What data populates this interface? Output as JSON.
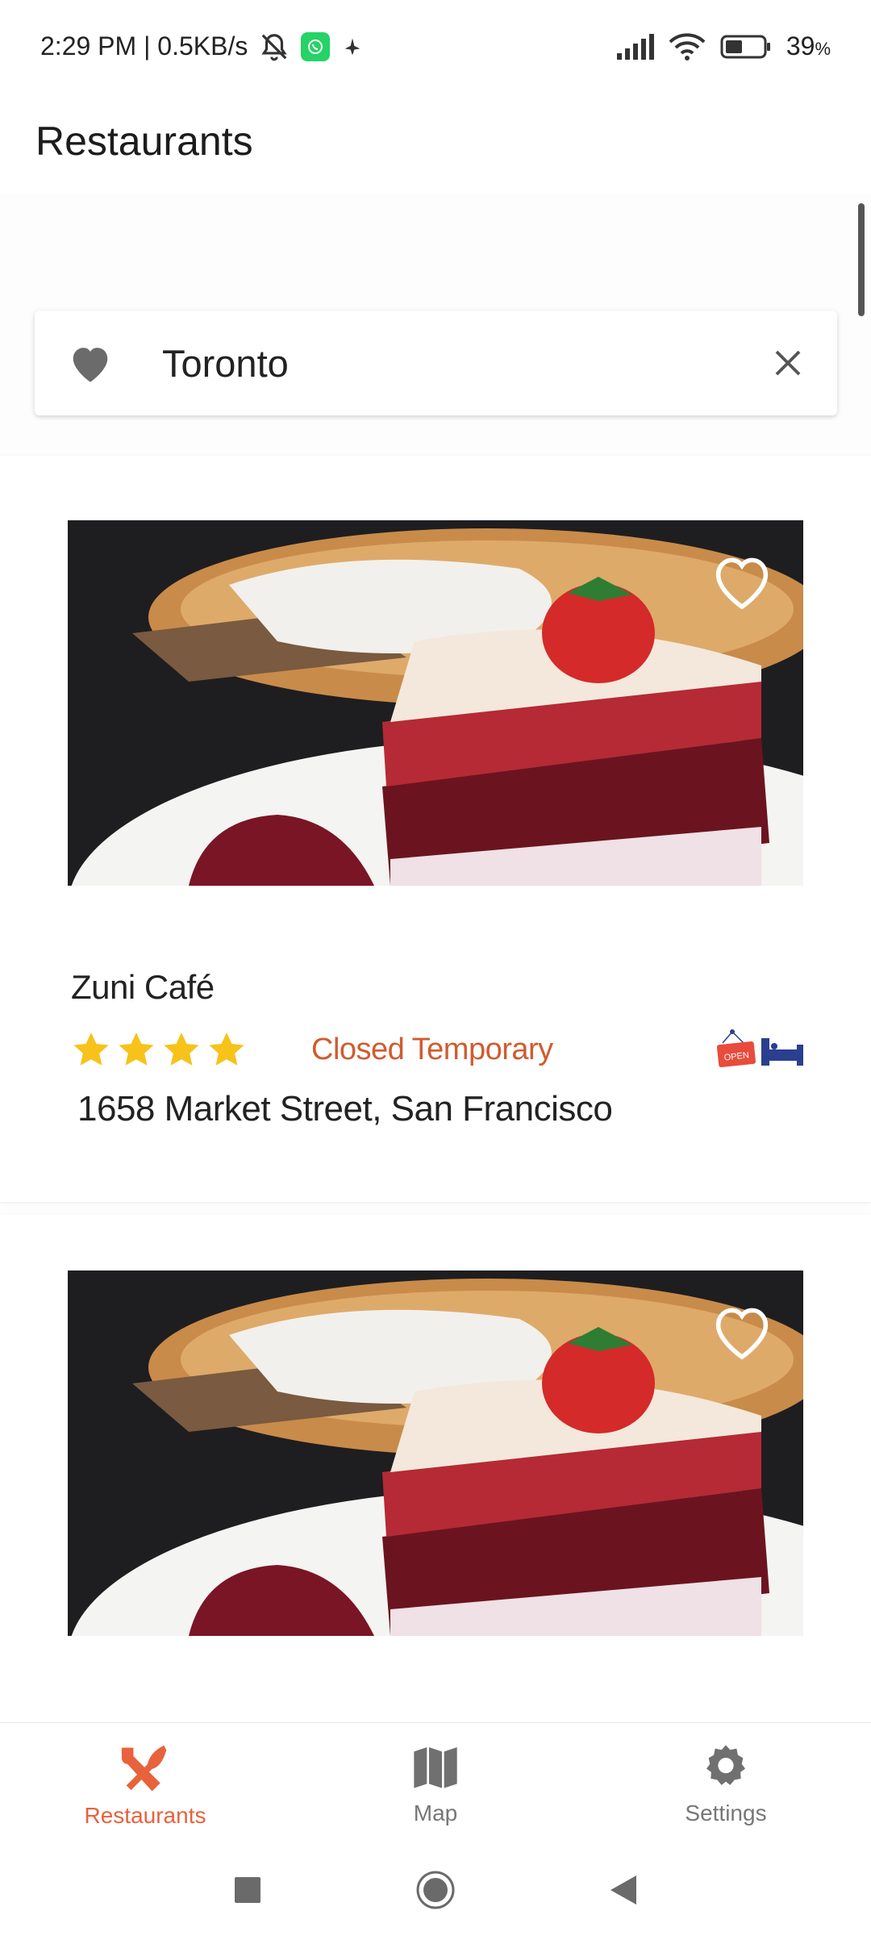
{
  "status_bar": {
    "time_speed": "2:29 PM | 0.5KB/s",
    "battery": "39",
    "battery_unit": "%"
  },
  "app_bar": {
    "title": "Restaurants"
  },
  "search": {
    "value": "Toronto"
  },
  "restaurants": [
    {
      "name": "Zuni Café",
      "rating_stars": 4,
      "status": "Closed Temporary",
      "address": "1658 Market Street, San Francisco",
      "open_sign_text": "OPEN"
    },
    {
      "name": "",
      "rating_stars": 0,
      "status": "",
      "address": ""
    }
  ],
  "bottom_nav": {
    "items": [
      {
        "label": "Restaurants",
        "icon": "fork-knife-icon",
        "active": true
      },
      {
        "label": "Map",
        "icon": "map-icon",
        "active": false
      },
      {
        "label": "Settings",
        "icon": "gear-icon",
        "active": false
      }
    ]
  },
  "colors": {
    "accent": "#e8623c",
    "status_closed": "#cf5c2f",
    "star": "#f7c21a"
  }
}
